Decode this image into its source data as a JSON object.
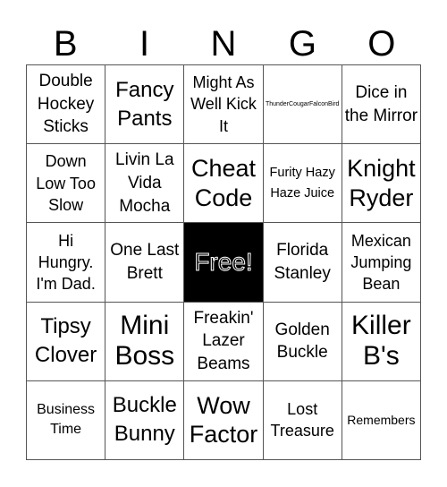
{
  "header": [
    "B",
    "I",
    "N",
    "G",
    "O"
  ],
  "cells": [
    "Double Hockey Sticks",
    "Fancy Pants",
    "Might As Well Kick It",
    "ThunderCougarFalconBird",
    "Dice in the Mirror",
    "Down Low Too Slow",
    "Livin La Vida Mocha",
    "Cheat Code",
    "Furity Hazy Haze Juice",
    "Knight Ryder",
    "Hi Hungry. I'm Dad.",
    "One Last Brett",
    "Free!",
    "Florida Stanley",
    "Mexican Jumping Bean",
    "Tipsy Clover",
    "Mini Boss",
    "Freakin' Lazer Beams",
    "Golden Buckle",
    "Killer B's",
    "Business Time",
    "Buckle Bunny",
    "Wow Factor",
    "Lost Treasure",
    "Remembers"
  ]
}
